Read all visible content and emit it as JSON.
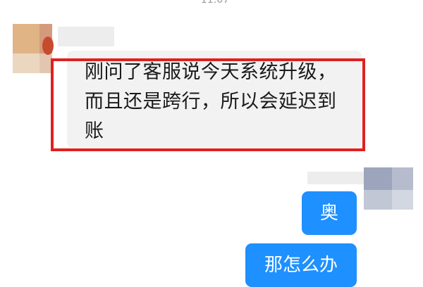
{
  "status": {
    "time": "11:07"
  },
  "messages": [
    {
      "sender": "contact",
      "text": "刚问了客服说今天系统升级，而且还是跨行，所以会延迟到账",
      "highlighted": true
    },
    {
      "sender": "me",
      "text": "奥"
    },
    {
      "sender": "me",
      "text": "那怎么办"
    }
  ],
  "colors": {
    "incoming_bubble": "#f2f2f2",
    "outgoing_bubble": "#1e90ff",
    "highlight_border": "#e02020"
  },
  "icons": {
    "contact_avatar": "blurred-avatar",
    "my_avatar": "blurred-avatar"
  }
}
